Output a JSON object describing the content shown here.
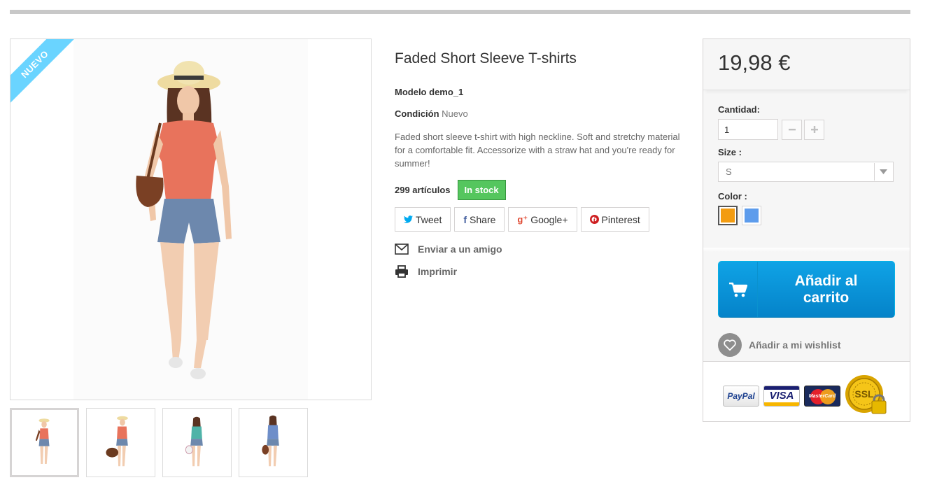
{
  "badge": {
    "label": "Nuevo"
  },
  "product": {
    "title": "Faded Short Sleeve T-shirts",
    "model_label": "Modelo",
    "model_value": "demo_1",
    "condition_label": "Condición",
    "condition_value": "Nuevo",
    "description": "Faded short sleeve t-shirt with high neckline. Soft and stretchy material for a comfortable fit. Accessorize with a straw hat and you're ready for summer!",
    "quantity_available": "299 artículos",
    "stock_status": "In stock"
  },
  "social": {
    "tweet": "Tweet",
    "share": "Share",
    "google": "Google+",
    "pinterest": "Pinterest"
  },
  "actions": {
    "send_friend": "Enviar a un amigo",
    "print": "Imprimir"
  },
  "buy_box": {
    "price": "19,98 €",
    "quantity_label": "Cantidad:",
    "quantity_value": "1",
    "size_label": "Size :",
    "size_value": "S",
    "color_label": "Color :",
    "colors": [
      "#f39c11",
      "#5d9cec"
    ],
    "add_to_cart": "Añadir al carrito",
    "wishlist": "Añadir a mi wishlist"
  },
  "payment": {
    "paypal": "PayPal",
    "visa": "VISA",
    "mastercard": "MasterCard",
    "ssl": "SSL"
  },
  "thumbnails": [
    {
      "name": "thumb-1",
      "shirt": "#e8735c"
    },
    {
      "name": "thumb-2",
      "shirt": "#e8735c"
    },
    {
      "name": "thumb-3",
      "shirt": "#4fb3a8"
    },
    {
      "name": "thumb-4",
      "shirt": "#6e8ec9"
    }
  ],
  "icons": [
    "cart-icon",
    "envelope-icon",
    "printer-icon",
    "heart-icon",
    "twitter-icon",
    "facebook-icon",
    "google-plus-icon",
    "pinterest-icon",
    "minus-icon",
    "plus-icon",
    "chevron-down-icon"
  ]
}
